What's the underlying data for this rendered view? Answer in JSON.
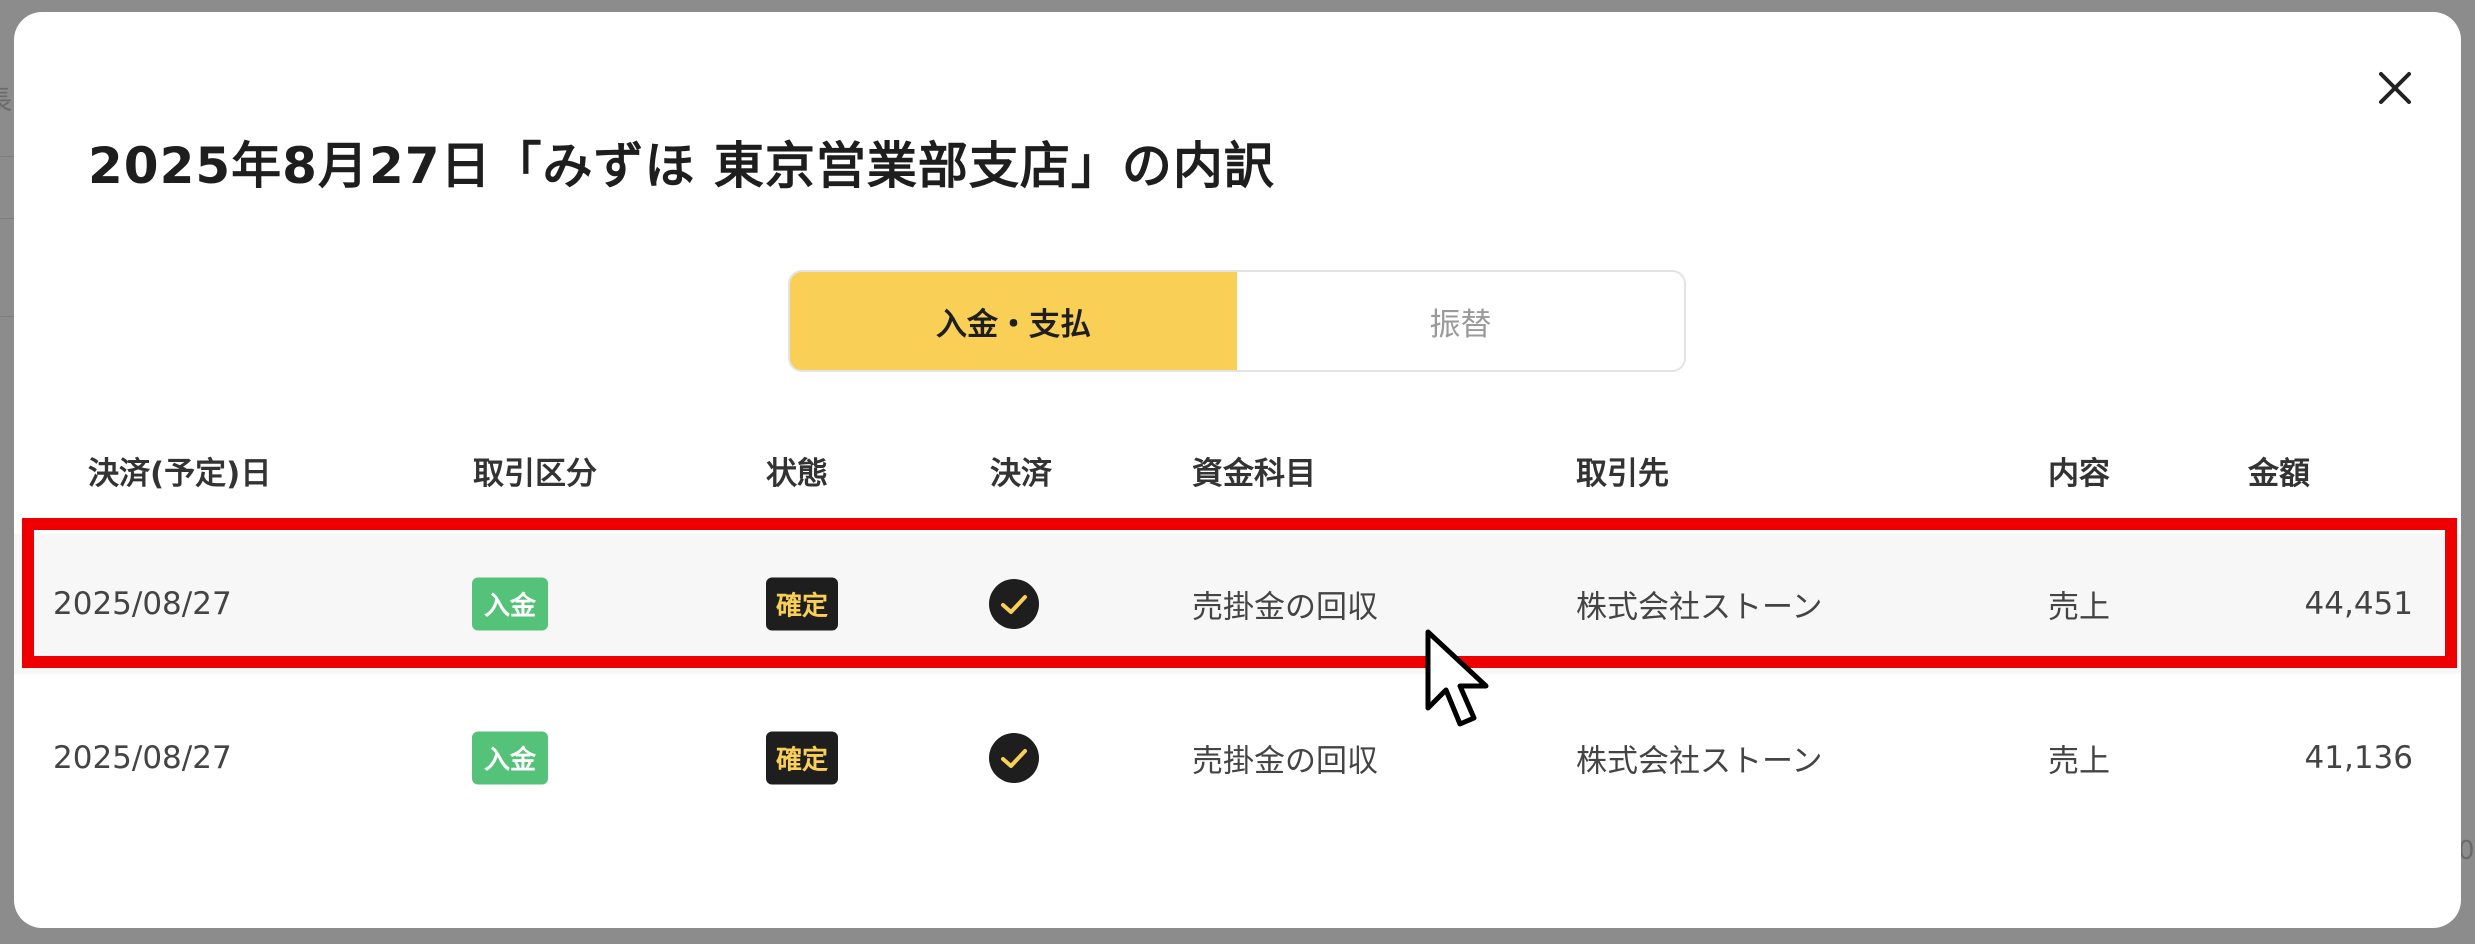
{
  "modal": {
    "title": "2025年8月27日「みずほ 東京営業部支店」の内訳",
    "close_label": "×"
  },
  "tabs": [
    {
      "label": "入金・支払",
      "active": true
    },
    {
      "label": "振替",
      "active": false
    }
  ],
  "table": {
    "headers": [
      "決済(予定)日",
      "取引区分",
      "状態",
      "決済",
      "資金科目",
      "取引先",
      "内容",
      "金額"
    ],
    "rows": [
      {
        "date": "2025/08/27",
        "type": "入金",
        "status": "確定",
        "settled": true,
        "account": "売掛金の回収",
        "partner": "株式会社ストーン",
        "description": "売上",
        "amount": "44,451",
        "highlighted": true
      },
      {
        "date": "2025/08/27",
        "type": "入金",
        "status": "確定",
        "settled": true,
        "account": "売掛金の回収",
        "partner": "株式会社ストーン",
        "description": "売上",
        "amount": "41,136",
        "highlighted": false
      }
    ]
  },
  "background": {
    "left_fragment": "長",
    "right_fragment": "0"
  },
  "colors": {
    "accent_yellow": "#f9cf55",
    "deposit_green": "#55c27a",
    "highlight_red": "#ee0000",
    "dark": "#1e1e1e"
  }
}
